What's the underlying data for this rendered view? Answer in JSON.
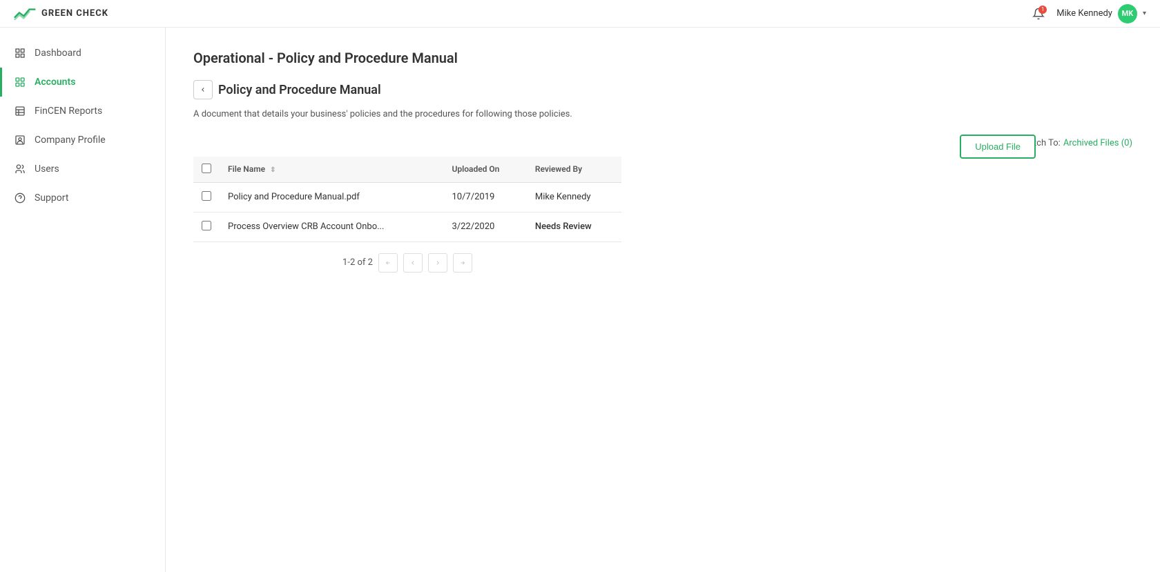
{
  "header": {
    "logo_text": "GREEN CHECK",
    "notification_count": "1",
    "user_name": "Mike Kennedy",
    "user_initials": "MK"
  },
  "sidebar": {
    "items": [
      {
        "id": "dashboard",
        "label": "Dashboard",
        "active": false
      },
      {
        "id": "accounts",
        "label": "Accounts",
        "active": true
      },
      {
        "id": "fincen-reports",
        "label": "FinCEN Reports",
        "active": false
      },
      {
        "id": "company-profile",
        "label": "Company Profile",
        "active": false
      },
      {
        "id": "users",
        "label": "Users",
        "active": false
      },
      {
        "id": "support",
        "label": "Support",
        "active": false
      }
    ]
  },
  "main": {
    "page_title": "Operational - Policy and Procedure Manual",
    "doc_title": "Policy and Procedure Manual",
    "doc_description": "A document that details your business' policies and the procedures for following those policies.",
    "switch_to_label": "Switch To:",
    "archived_files_link": "Archived Files (0)",
    "upload_btn_label": "Upload File",
    "table": {
      "columns": [
        {
          "id": "file_name",
          "label": "File Name",
          "sortable": true
        },
        {
          "id": "uploaded_on",
          "label": "Uploaded On"
        },
        {
          "id": "reviewed_by",
          "label": "Reviewed By"
        }
      ],
      "rows": [
        {
          "file_name": "Policy and Procedure Manual.pdf",
          "uploaded_on": "10/7/2019",
          "reviewed_by": "Mike Kennedy",
          "needs_review": false
        },
        {
          "file_name": "Process Overview CRB Account Onbo...",
          "uploaded_on": "3/22/2020",
          "reviewed_by": "Needs Review",
          "needs_review": true
        }
      ],
      "pagination": {
        "current": "1-2 of 2"
      }
    }
  }
}
